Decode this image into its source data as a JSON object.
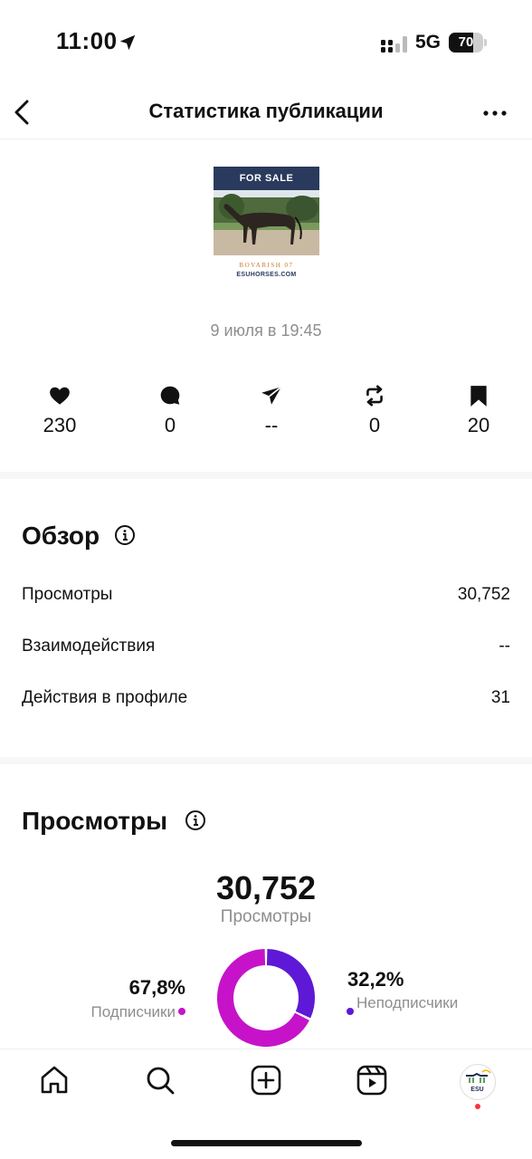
{
  "status_bar": {
    "time": "11:00",
    "network": "5G",
    "battery_level": 70,
    "battery_label": "70"
  },
  "header": {
    "title": "Статистика публикации",
    "back_icon": "chevron-left-icon",
    "more_icon": "more-horizontal-icon"
  },
  "post": {
    "thumbnail": {
      "banner_text": "FOR SALE",
      "horse_name": "BOVARISH 07",
      "website": "ESUHORSES.COM"
    },
    "date": "9 июля в 19:45"
  },
  "metrics": [
    {
      "icon": "heart-icon",
      "value": "230"
    },
    {
      "icon": "comment-icon",
      "value": "0"
    },
    {
      "icon": "share-icon",
      "value": "--"
    },
    {
      "icon": "repost-icon",
      "value": "0"
    },
    {
      "icon": "bookmark-icon",
      "value": "20"
    }
  ],
  "overview": {
    "title": "Обзор",
    "rows": [
      {
        "label": "Просмотры",
        "value": "30,752"
      },
      {
        "label": "Взаимодействия",
        "value": "--"
      },
      {
        "label": "Действия в профиле",
        "value": "31"
      }
    ]
  },
  "views": {
    "title": "Просмотры",
    "total": "30,752",
    "total_label": "Просмотры",
    "followers": {
      "percent_text": "67,8%",
      "label": "Подписчики",
      "fraction": 0.678,
      "color": "#c613c9"
    },
    "non_followers": {
      "percent_text": "32,2%",
      "label": "Неподписчики",
      "fraction": 0.322,
      "color": "#5d19d6"
    }
  },
  "tabbar": {
    "items": [
      "home-icon",
      "search-icon",
      "create-icon",
      "reels-icon",
      "profile-avatar"
    ],
    "avatar_text": "ESU"
  },
  "colors": {
    "followers": "#c613c9",
    "non_followers": "#5d19d6",
    "muted_text": "#8e8e8e",
    "notification": "#ff3040"
  }
}
